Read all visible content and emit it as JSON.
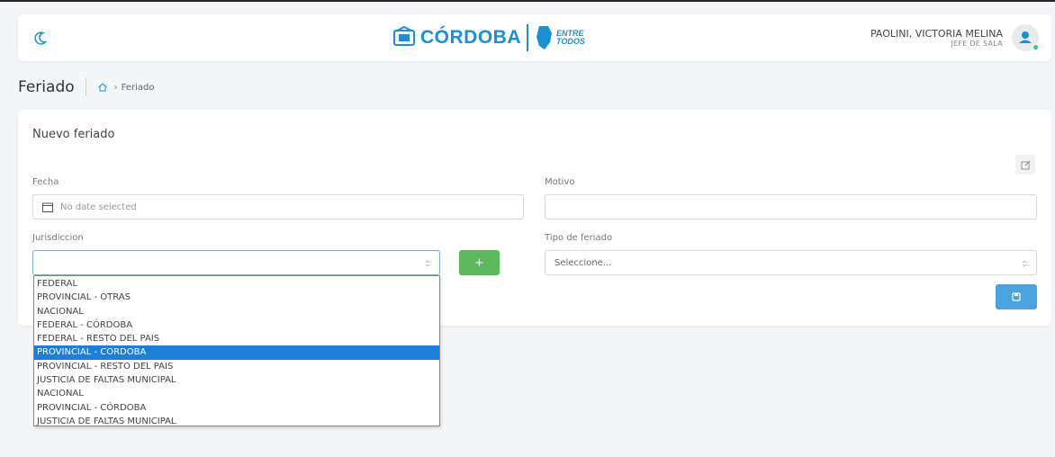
{
  "header": {
    "logo_city": "CÓRDOBA",
    "logo_slogan_1": "ENTRE",
    "logo_slogan_2": "TODOS",
    "user_name": "PAOLINI, VICTORIA MELINA",
    "user_role": "JEFE DE SALA"
  },
  "page": {
    "title": "Feriado",
    "breadcrumb": "Feriado"
  },
  "form": {
    "card_title": "Nuevo feriado",
    "fecha_label": "Fecha",
    "fecha_placeholder": "No date selected",
    "motivo_label": "Motivo",
    "motivo_value": "",
    "jurisdiccion_label": "Jurisdiccion",
    "jurisdiccion_value": "",
    "add_label": "+",
    "tipo_label": "Tipo de feriado",
    "tipo_value": "Seleccione..."
  },
  "dropdown": {
    "options": [
      "FEDERAL",
      "PROVINCIAL - OTRAS",
      "NACIONAL",
      "FEDERAL - CÓRDOBA",
      "FEDERAL - RESTO DEL PAIS",
      "PROVINCIAL - CORDOBA",
      "PROVINCIAL - RESTO DEL PAIS",
      "JUSTICIA DE FALTAS MUNICIPAL",
      "NACIONAL",
      "PROVINCIAL - CÓRDOBA",
      "JUSTICIA DE FALTAS MUNICIPAL"
    ],
    "highlighted": "PROVINCIAL - CORDOBA"
  },
  "colors": {
    "brand": "#1a8fd1",
    "add_button": "#5cb85c",
    "save_button": "#4aa3df",
    "highlight": "#1e7fd8",
    "status_online": "#2ecc71"
  },
  "icons": [
    "moon-icon",
    "home-icon",
    "calendar-icon",
    "edit-icon",
    "save-icon",
    "user-icon",
    "select-arrows-icon"
  ]
}
